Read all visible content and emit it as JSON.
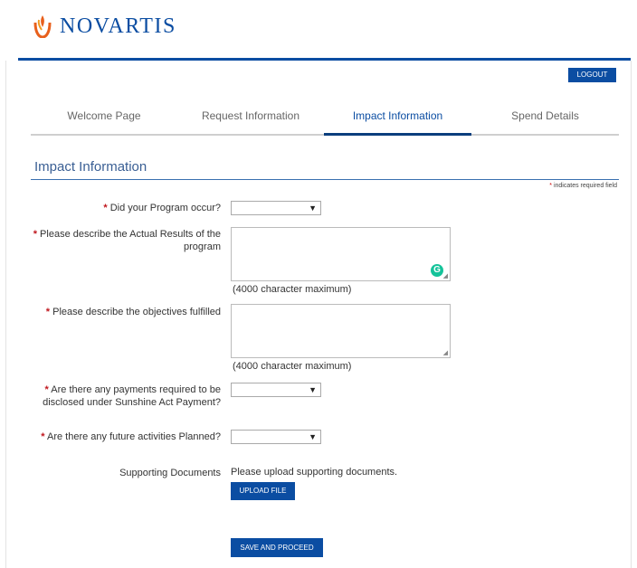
{
  "brand": {
    "name": "NOVARTIS",
    "logo_icon": "novartis-flame-icon",
    "color": "#0b4da2"
  },
  "header": {
    "logout_label": "LOGOUT"
  },
  "tabs": [
    {
      "label": "Welcome Page",
      "active": false
    },
    {
      "label": "Request Information",
      "active": false
    },
    {
      "label": "Impact Information",
      "active": true
    },
    {
      "label": "Spend Details",
      "active": false
    }
  ],
  "section": {
    "title": "Impact Information",
    "required_note": "indicates required field",
    "required_mark": "*"
  },
  "form": {
    "program_occur": {
      "label": "Did your Program occur?",
      "value": ""
    },
    "actual_results": {
      "label": "Please describe the Actual Results of the program",
      "value": "",
      "hint": "(4000 character maximum)"
    },
    "objectives": {
      "label": "Please describe the objectives fulfilled",
      "value": "",
      "hint": "(4000 character maximum)"
    },
    "sunshine": {
      "label": "Are there any payments required to be disclosed under Sunshine Act Payment?",
      "value": ""
    },
    "future": {
      "label": "Are there any future activities Planned?",
      "value": ""
    },
    "supporting": {
      "label": "Supporting Documents",
      "text": "Please upload supporting documents.",
      "button": "UPLOAD FILE"
    },
    "save_label": "SAVE AND PROCEED"
  }
}
